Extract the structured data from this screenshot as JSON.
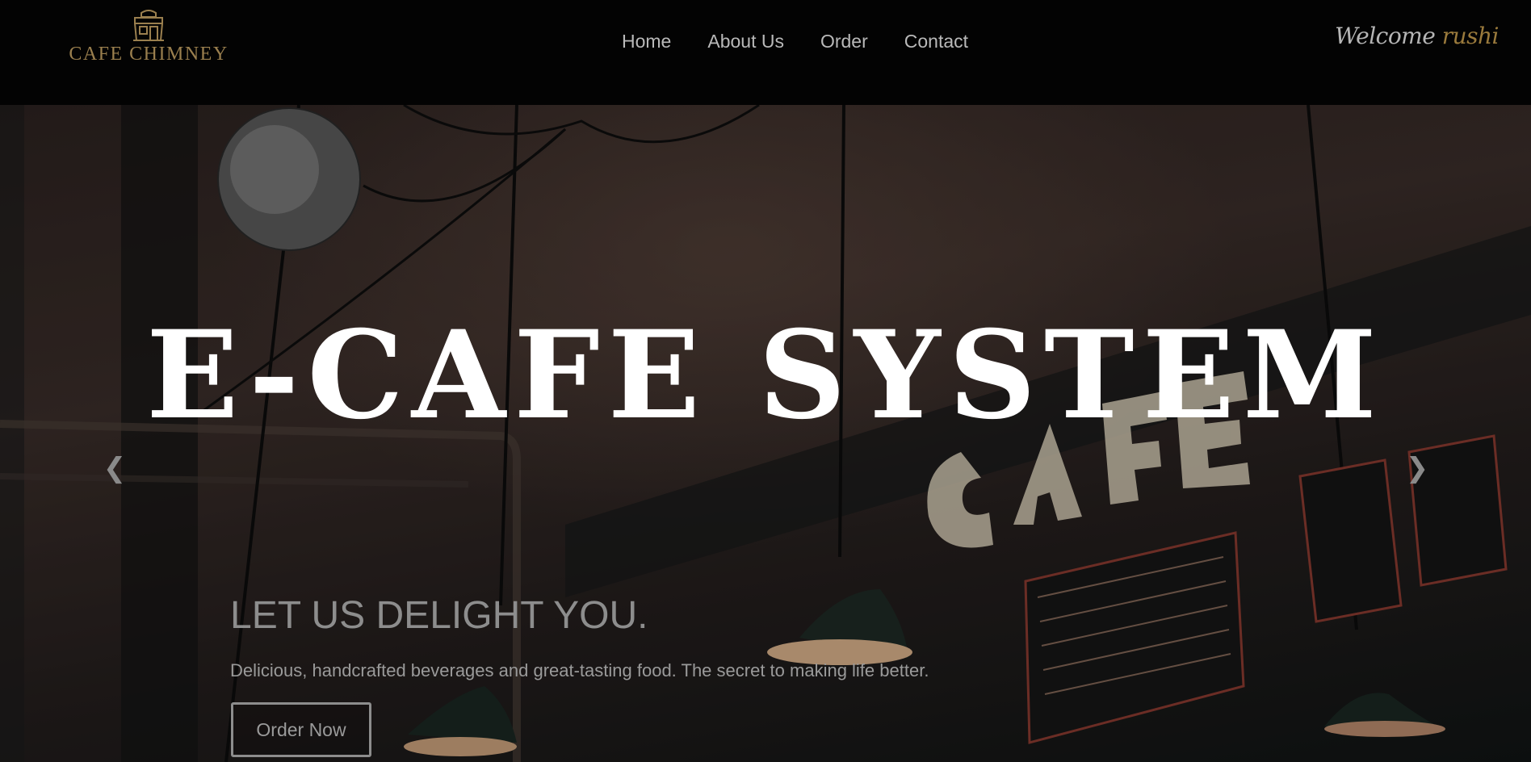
{
  "brand": {
    "name": "CAFE CHIMNEY",
    "logo_icon": "cafe-storefront-icon",
    "color": "#9a7f4e"
  },
  "nav": {
    "items": [
      {
        "label": "Home"
      },
      {
        "label": "About Us"
      },
      {
        "label": "Order"
      },
      {
        "label": "Contact"
      }
    ]
  },
  "user": {
    "greeting": "Welcome",
    "name": "rushi",
    "name_color": "#9a7a3c"
  },
  "hero": {
    "title": "E-CAFE SYSTEM",
    "caption_heading": "LET US DELIGHT YOU.",
    "caption_text": "Delicious, handcrafted beverages and great-tasting food. The secret to making life better.",
    "cta_label": "Order Now",
    "prev_icon": "chevron-left-icon",
    "next_icon": "chevron-right-icon"
  }
}
